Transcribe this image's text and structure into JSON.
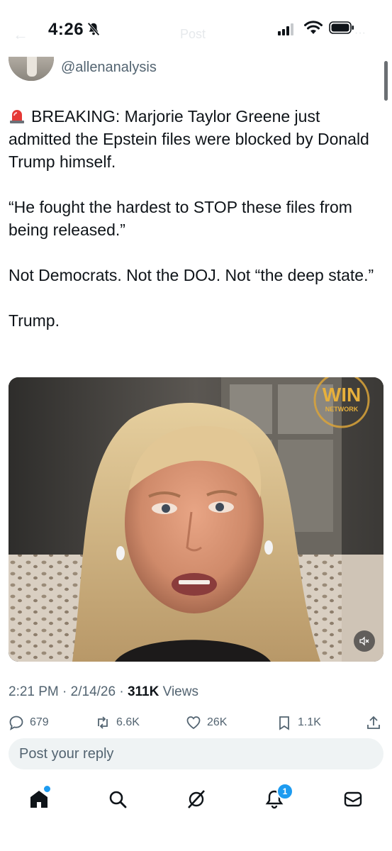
{
  "status_bar": {
    "time": "4:26",
    "ghost_title": "Post"
  },
  "post": {
    "handle": "@allenanalysis",
    "paragraphs": [
      "BREAKING: Marjorie Taylor Greene just admitted the Epstein files were blocked by Donald Trump himself.",
      "“He fought the hardest to STOP these files from being released.”",
      "Not Democrats. Not the DOJ. Not “the deep state.”",
      "Trump."
    ],
    "video": {
      "logo_main": "WIN",
      "logo_sub": "NETWORK"
    },
    "meta": {
      "time": "2:21 PM",
      "date": "2/14/26",
      "views_count": "311K",
      "views_label": "Views"
    },
    "actions": {
      "replies": "679",
      "reposts": "6.6K",
      "likes": "26K",
      "bookmarks": "1.1K"
    }
  },
  "reply": {
    "placeholder": "Post your reply"
  },
  "tabbar": {
    "notifications_badge": "1"
  }
}
